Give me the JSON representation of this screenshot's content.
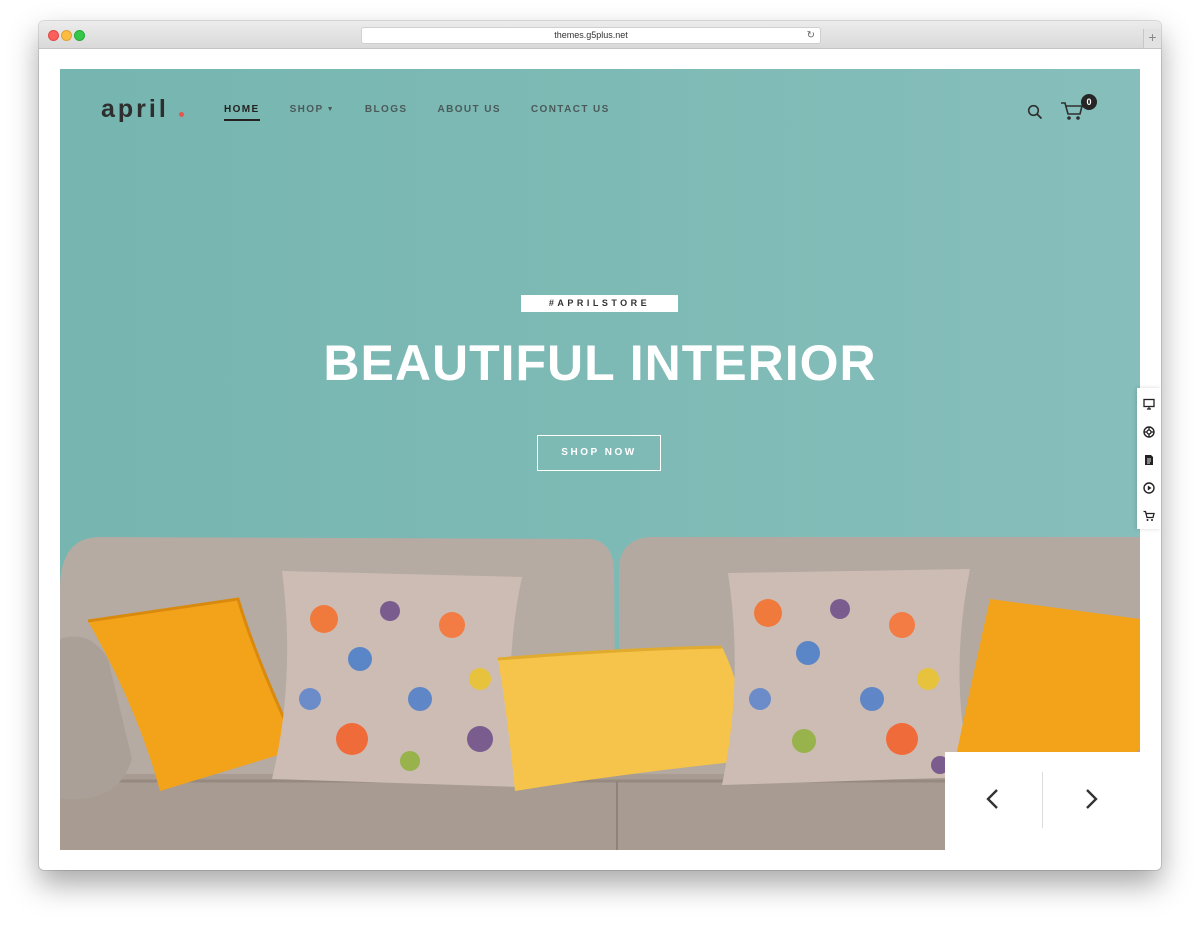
{
  "browser": {
    "url": "themes.g5plus.net",
    "reload_icon": "reload-icon",
    "new_tab_label": "+"
  },
  "header": {
    "logo_text": "april",
    "logo_dot_color": "#e8544e",
    "nav": [
      {
        "label": "HOME",
        "active": true
      },
      {
        "label": "SHOP",
        "active": false,
        "dropdown": true
      },
      {
        "label": "BLOGS",
        "active": false
      },
      {
        "label": "ABOUT US",
        "active": false
      },
      {
        "label": "CONTACT US",
        "active": false
      }
    ],
    "cart_count": "0"
  },
  "hero": {
    "tag": "#APRILSTORE",
    "headline": "BEAUTIFUL INTERIOR",
    "button_label": "SHOP NOW",
    "background_color": "#7ebab5"
  },
  "side_tools": [
    "monitor-icon",
    "lifebuoy-icon",
    "document-icon",
    "play-icon",
    "cart-icon"
  ]
}
